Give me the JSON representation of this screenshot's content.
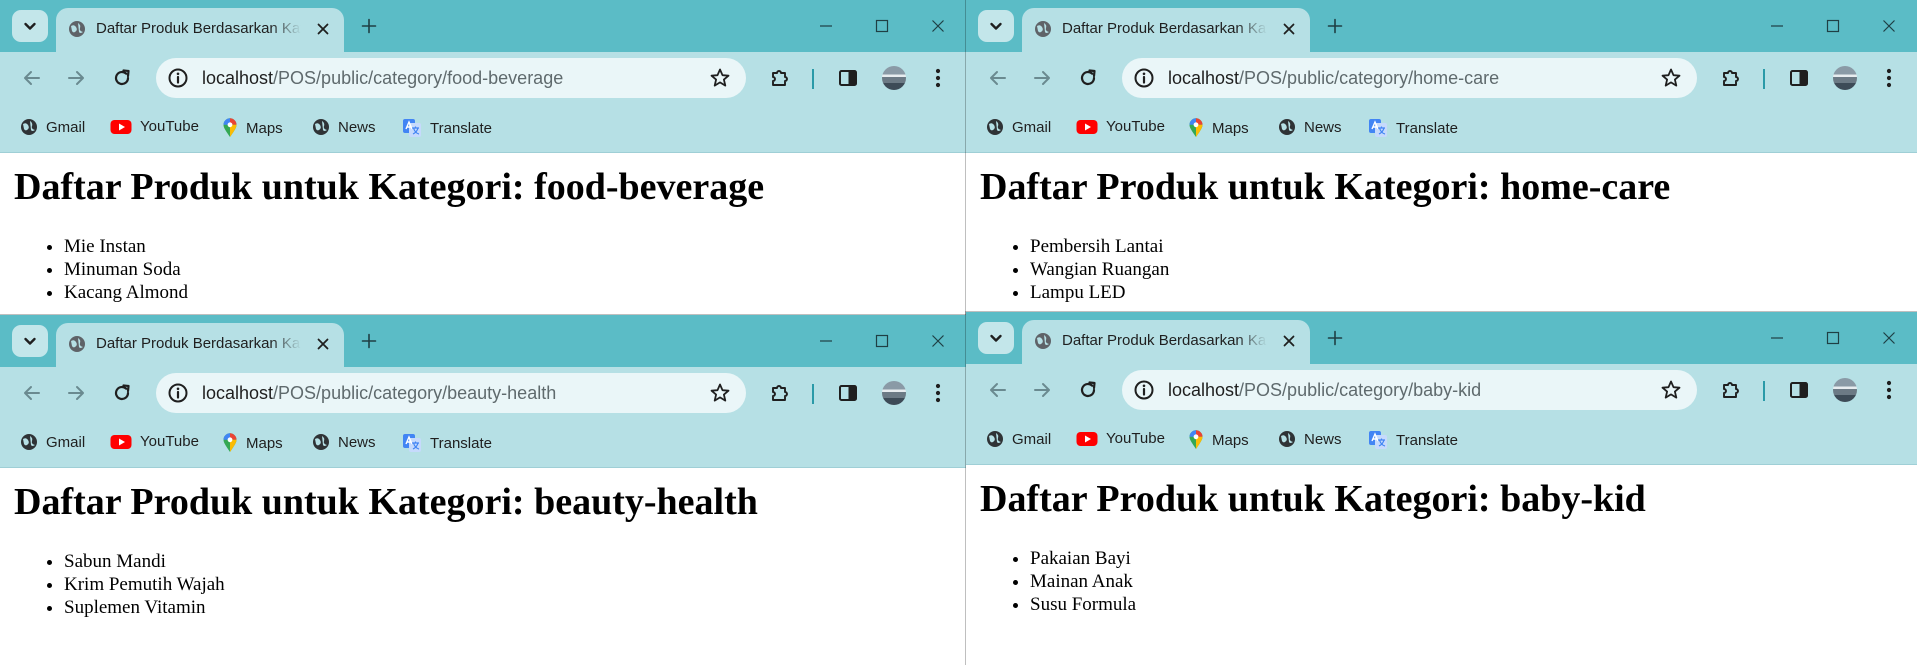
{
  "windows": [
    {
      "tab_title": "Daftar Produk Berdasarkan Kategori",
      "url_host": "localhost",
      "url_path": "/POS/public/category/food-beverage",
      "bookmarks": [
        "Gmail",
        "YouTube",
        "Maps",
        "News",
        "Translate"
      ],
      "heading": "Daftar Produk untuk Kategori: food-beverage",
      "products": [
        "Mie Instan",
        "Minuman Soda",
        "Kacang Almond"
      ]
    },
    {
      "tab_title": "Daftar Produk Berdasarkan Kategori",
      "url_host": "localhost",
      "url_path": "/POS/public/category/home-care",
      "bookmarks": [
        "Gmail",
        "YouTube",
        "Maps",
        "News",
        "Translate"
      ],
      "heading": "Daftar Produk untuk Kategori: home-care",
      "products": [
        "Pembersih Lantai",
        "Wangian Ruangan",
        "Lampu LED"
      ]
    },
    {
      "tab_title": "Daftar Produk Berdasarkan Kategori",
      "url_host": "localhost",
      "url_path": "/POS/public/category/beauty-health",
      "bookmarks": [
        "Gmail",
        "YouTube",
        "Maps",
        "News",
        "Translate"
      ],
      "heading": "Daftar Produk untuk Kategori: beauty-health",
      "products": [
        "Sabun Mandi",
        "Krim Pemutih Wajah",
        "Suplemen Vitamin"
      ]
    },
    {
      "tab_title": "Daftar Produk Berdasarkan Kategori",
      "url_host": "localhost",
      "url_path": "/POS/public/category/baby-kid",
      "bookmarks": [
        "Gmail",
        "YouTube",
        "Maps",
        "News",
        "Translate"
      ],
      "heading": "Daftar Produk untuk Kategori: baby-kid",
      "products": [
        "Pakaian Bayi",
        "Mainan Anak",
        "Susu Formula"
      ]
    }
  ],
  "icons": {
    "tab_dropdown": "chevron-down-icon",
    "favicon": "globe-icon",
    "close": "close-icon",
    "new_tab": "plus-icon",
    "minimize": "minimize-icon",
    "maximize": "maximize-icon",
    "back": "back-arrow-icon",
    "forward": "forward-arrow-icon",
    "reload": "reload-icon",
    "site_info": "site-info-icon",
    "bookmark_star": "star-icon",
    "extensions": "puzzle-icon",
    "side_panel": "side-panel-icon",
    "menu": "kebab-menu-icon",
    "bookmark_icons": [
      "globe-icon",
      "youtube-icon",
      "maps-pin-icon",
      "globe-icon",
      "translate-icon"
    ]
  },
  "colors": {
    "tab_strip": "#5bbcc6",
    "toolbar": "#b6e0e5",
    "omnibox": "#eaf6f8",
    "youtube_red": "#ff0000",
    "translate_blue": "#4285f4"
  }
}
